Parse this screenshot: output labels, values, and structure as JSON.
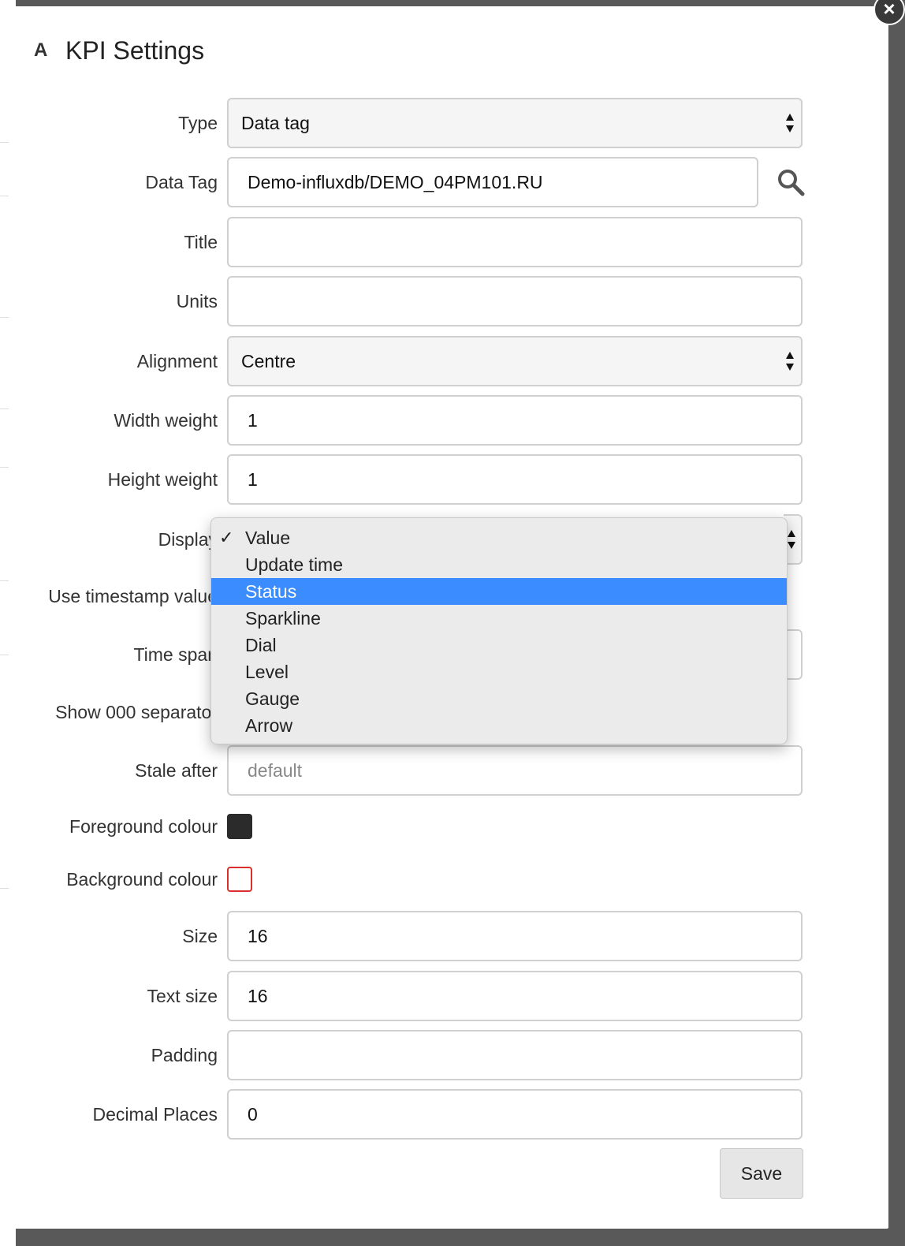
{
  "dialog": {
    "title": "KPI Settings",
    "title_icon": "A"
  },
  "fields": {
    "type": {
      "label": "Type",
      "value": "Data tag"
    },
    "data_tag": {
      "label": "Data Tag",
      "value": "Demo-influxdb/DEMO_04PM101.RU"
    },
    "title": {
      "label": "Title",
      "value": ""
    },
    "units": {
      "label": "Units",
      "value": ""
    },
    "alignment": {
      "label": "Alignment",
      "value": "Centre"
    },
    "width_weight": {
      "label": "Width weight",
      "value": "1"
    },
    "height_weight": {
      "label": "Height weight",
      "value": "1"
    },
    "display": {
      "label": "Display"
    },
    "use_timestamp": {
      "label": "Use timestamp value"
    },
    "time_span": {
      "label": "Time span"
    },
    "show_separator": {
      "label": "Show 000 separator"
    },
    "stale_after": {
      "label": "Stale after",
      "placeholder": "default"
    },
    "foreground_colour": {
      "label": "Foreground colour",
      "color": "#2b2b2b"
    },
    "background_colour": {
      "label": "Background colour",
      "color": "#ffffff",
      "border": "#d9302c"
    },
    "size": {
      "label": "Size",
      "value": "16"
    },
    "text_size": {
      "label": "Text size",
      "value": "16"
    },
    "padding": {
      "label": "Padding",
      "value": ""
    },
    "decimal_places": {
      "label": "Decimal Places",
      "value": "0"
    }
  },
  "display_options": [
    {
      "label": "Value",
      "checked": true
    },
    {
      "label": "Update time"
    },
    {
      "label": "Status",
      "highlighted": true
    },
    {
      "label": "Sparkline"
    },
    {
      "label": "Dial"
    },
    {
      "label": "Level"
    },
    {
      "label": "Gauge"
    },
    {
      "label": "Arrow"
    }
  ],
  "buttons": {
    "save": "Save",
    "close": "×"
  },
  "icons": {
    "search": "search-icon",
    "check": "✓"
  },
  "colors": {
    "highlight": "#3b8cff"
  }
}
